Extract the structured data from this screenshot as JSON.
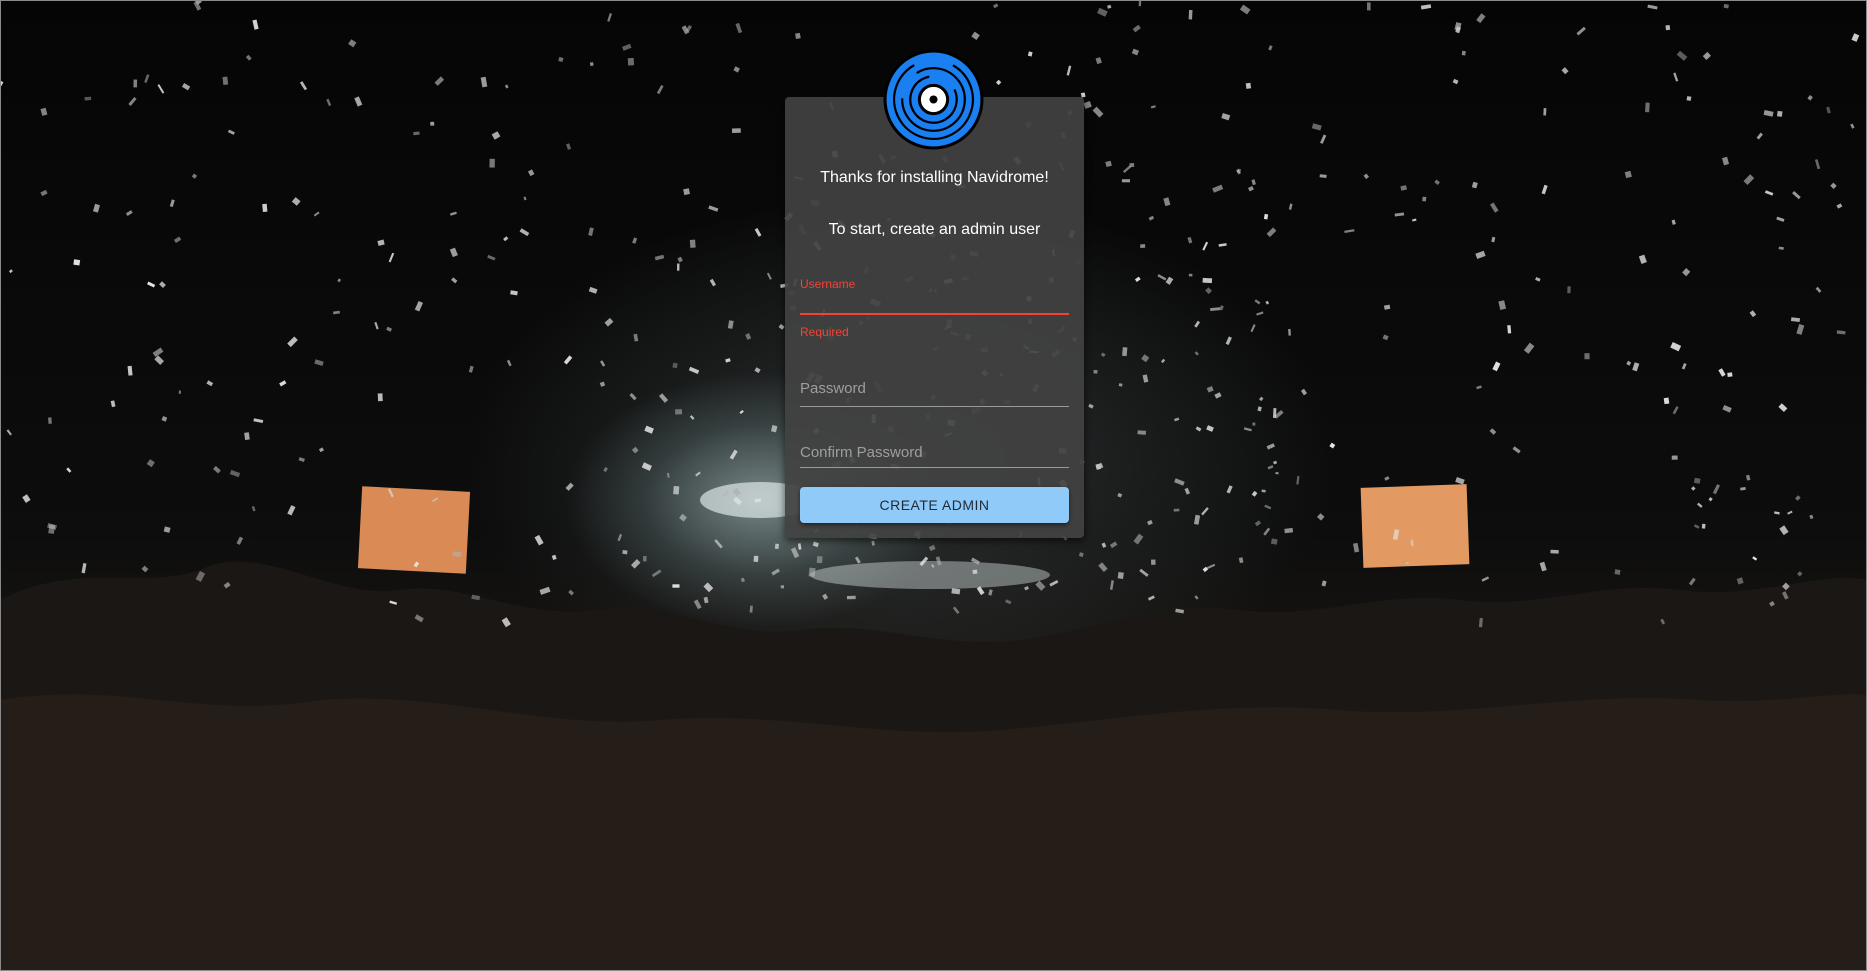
{
  "setup": {
    "title": "Thanks for installing Navidrome!",
    "subtitle": "To start, create an admin user",
    "fields": {
      "username": {
        "label": "Username",
        "value": "",
        "helper": "Required"
      },
      "password": {
        "label": "Password",
        "value": ""
      },
      "confirm_password": {
        "label": "Confirm Password",
        "value": ""
      }
    },
    "submit_label": "CREATE ADMIN"
  },
  "logo": {
    "icon": "vinyl-record-icon",
    "color": "#1a7ff0"
  },
  "colors": {
    "error": "#f44336",
    "button": "#90caf9",
    "card": "#424242"
  }
}
